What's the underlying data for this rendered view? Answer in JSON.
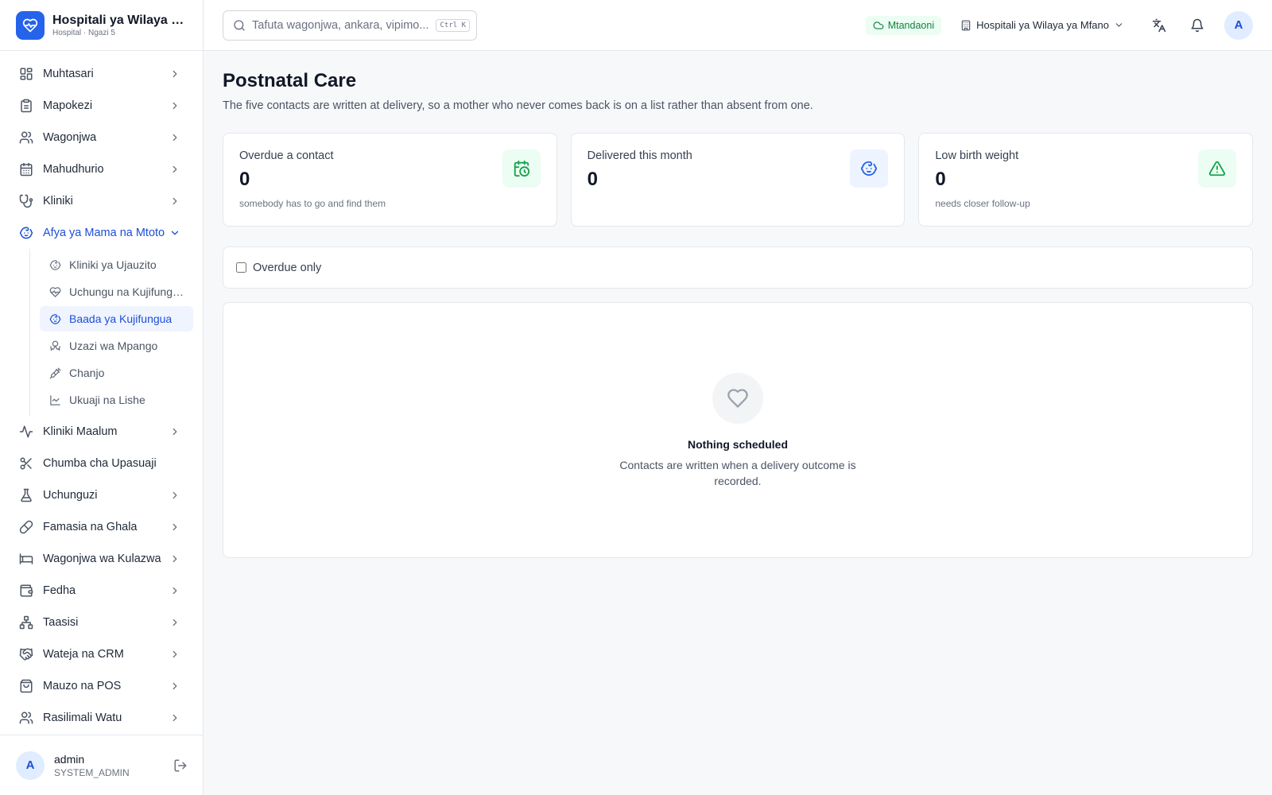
{
  "brand": {
    "title": "Hospitali ya Wilaya ya Mfano",
    "subtitle": "Hospital · Ngazi 5"
  },
  "sidebar": {
    "items": [
      {
        "label": "Muhtasari",
        "icon": "dashboard-icon"
      },
      {
        "label": "Mapokezi",
        "icon": "clipboard-icon"
      },
      {
        "label": "Wagonjwa",
        "icon": "users-icon"
      },
      {
        "label": "Mahudhurio",
        "icon": "calendar-icon"
      },
      {
        "label": "Kliniki",
        "icon": "stethoscope-icon"
      },
      {
        "label": "Afya ya Mama na Mtoto",
        "icon": "baby-icon"
      },
      {
        "label": "Kliniki Maalum",
        "icon": "activity-icon"
      },
      {
        "label": "Chumba cha Upasuaji",
        "icon": "scissors-icon"
      },
      {
        "label": "Uchunguzi",
        "icon": "flask-icon"
      },
      {
        "label": "Famasia na Ghala",
        "icon": "pill-icon"
      },
      {
        "label": "Wagonjwa wa Kulazwa",
        "icon": "bed-icon"
      },
      {
        "label": "Fedha",
        "icon": "wallet-icon"
      },
      {
        "label": "Taasisi",
        "icon": "network-icon"
      },
      {
        "label": "Wateja na CRM",
        "icon": "handshake-icon"
      },
      {
        "label": "Mauzo na POS",
        "icon": "shopping-bag-icon"
      },
      {
        "label": "Rasilimali Watu",
        "icon": "users-icon"
      }
    ],
    "subitems": [
      {
        "label": "Kliniki ya Ujauzito",
        "icon": "baby-icon"
      },
      {
        "label": "Uchungu na Kujifungua",
        "icon": "heart-pulse-icon"
      },
      {
        "label": "Baada ya Kujifungua",
        "icon": "baby-icon"
      },
      {
        "label": "Uzazi wa Mpango",
        "icon": "ribbon-icon"
      },
      {
        "label": "Chanjo",
        "icon": "syringe-icon"
      },
      {
        "label": "Ukuaji na Lishe",
        "icon": "line-chart-icon"
      }
    ]
  },
  "user": {
    "initial": "A",
    "name": "admin",
    "role": "SYSTEM_ADMIN"
  },
  "topbar": {
    "search_placeholder": "Tafuta wagonjwa, ankara, vipimo...",
    "shortcut": "Ctrl K",
    "status": "Mtandaoni",
    "facility": "Hospitali ya Wilaya ya Mfano",
    "avatar_initial": "A"
  },
  "page": {
    "title": "Postnatal Care",
    "description": "The five contacts are written at delivery, so a mother who never comes back is on a list rather than absent from one."
  },
  "stats": [
    {
      "label": "Overdue a contact",
      "value": "0",
      "note": "somebody has to go and find them",
      "icon": "calendar-clock-icon",
      "color": "#16a34a"
    },
    {
      "label": "Delivered this month",
      "value": "0",
      "note": "",
      "icon": "baby-icon",
      "color": "#2563eb"
    },
    {
      "label": "Low birth weight",
      "value": "0",
      "note": "needs closer follow-up",
      "icon": "alert-triangle-icon",
      "color": "#16a34a"
    }
  ],
  "filter": {
    "overdue_label": "Overdue only",
    "checked": false
  },
  "empty": {
    "title": "Nothing scheduled",
    "description": "Contacts are written when a delivery outcome is recorded."
  },
  "colors": {
    "accent": "#2563eb",
    "active_text": "#1d4ed8",
    "online": "#15803d"
  }
}
